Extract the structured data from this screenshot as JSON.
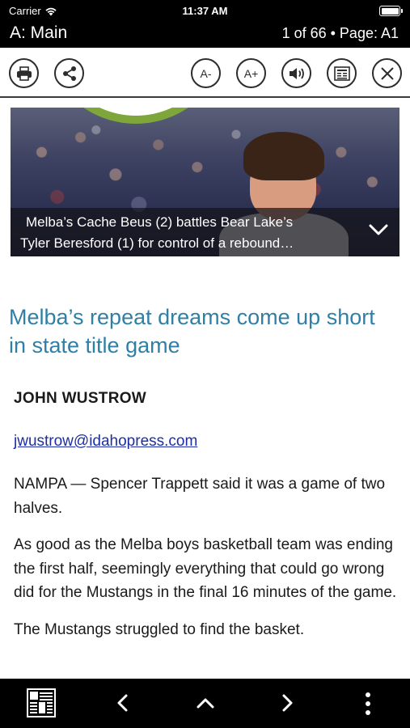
{
  "status_bar": {
    "carrier": "Carrier",
    "time": "11:37 AM",
    "battery_level": 1.0
  },
  "header": {
    "section": "A: Main",
    "page_info": "1 of 66 • Page: A1"
  },
  "toolbar": {
    "print_icon": "printer-icon",
    "share_icon": "share-icon",
    "font_decrease_label": "A-",
    "font_increase_label": "A+",
    "audio_icon": "speaker-icon",
    "page_view_icon": "newspaper-page-icon",
    "close_icon": "close-icon"
  },
  "photo": {
    "caption_line1": "Melba’s Cache Beus (2) battles Bear Lake’s",
    "caption_line2": "Tyler Beresford (1) for control of a rebound…",
    "expand_icon": "chevron-down-icon"
  },
  "article": {
    "headline": "Melba’s repeat dreams come up short in state title game",
    "author": "JOHN WUSTROW",
    "email": "jwustrow@idahopress.com",
    "paragraphs": [
      "NAMPA — Spencer Trappett said it was a game of two halves.",
      "As good as the Melba boys basketball team was ending the first half, seemingly everything that could go wrong did for the Mustangs in the final 16 minutes of the game.",
      "The Mustangs struggled to find the basket."
    ]
  },
  "bottom_bar": {
    "pages_icon": "page-grid-icon",
    "prev_icon": "chevron-left-icon",
    "up_icon": "chevron-up-icon",
    "next_icon": "chevron-right-icon",
    "more_icon": "more-vertical-icon"
  },
  "colors": {
    "headline": "#2f7fa6",
    "link": "#1b2ea8",
    "bar": "#000000",
    "logo_green": "#7fa63a"
  }
}
